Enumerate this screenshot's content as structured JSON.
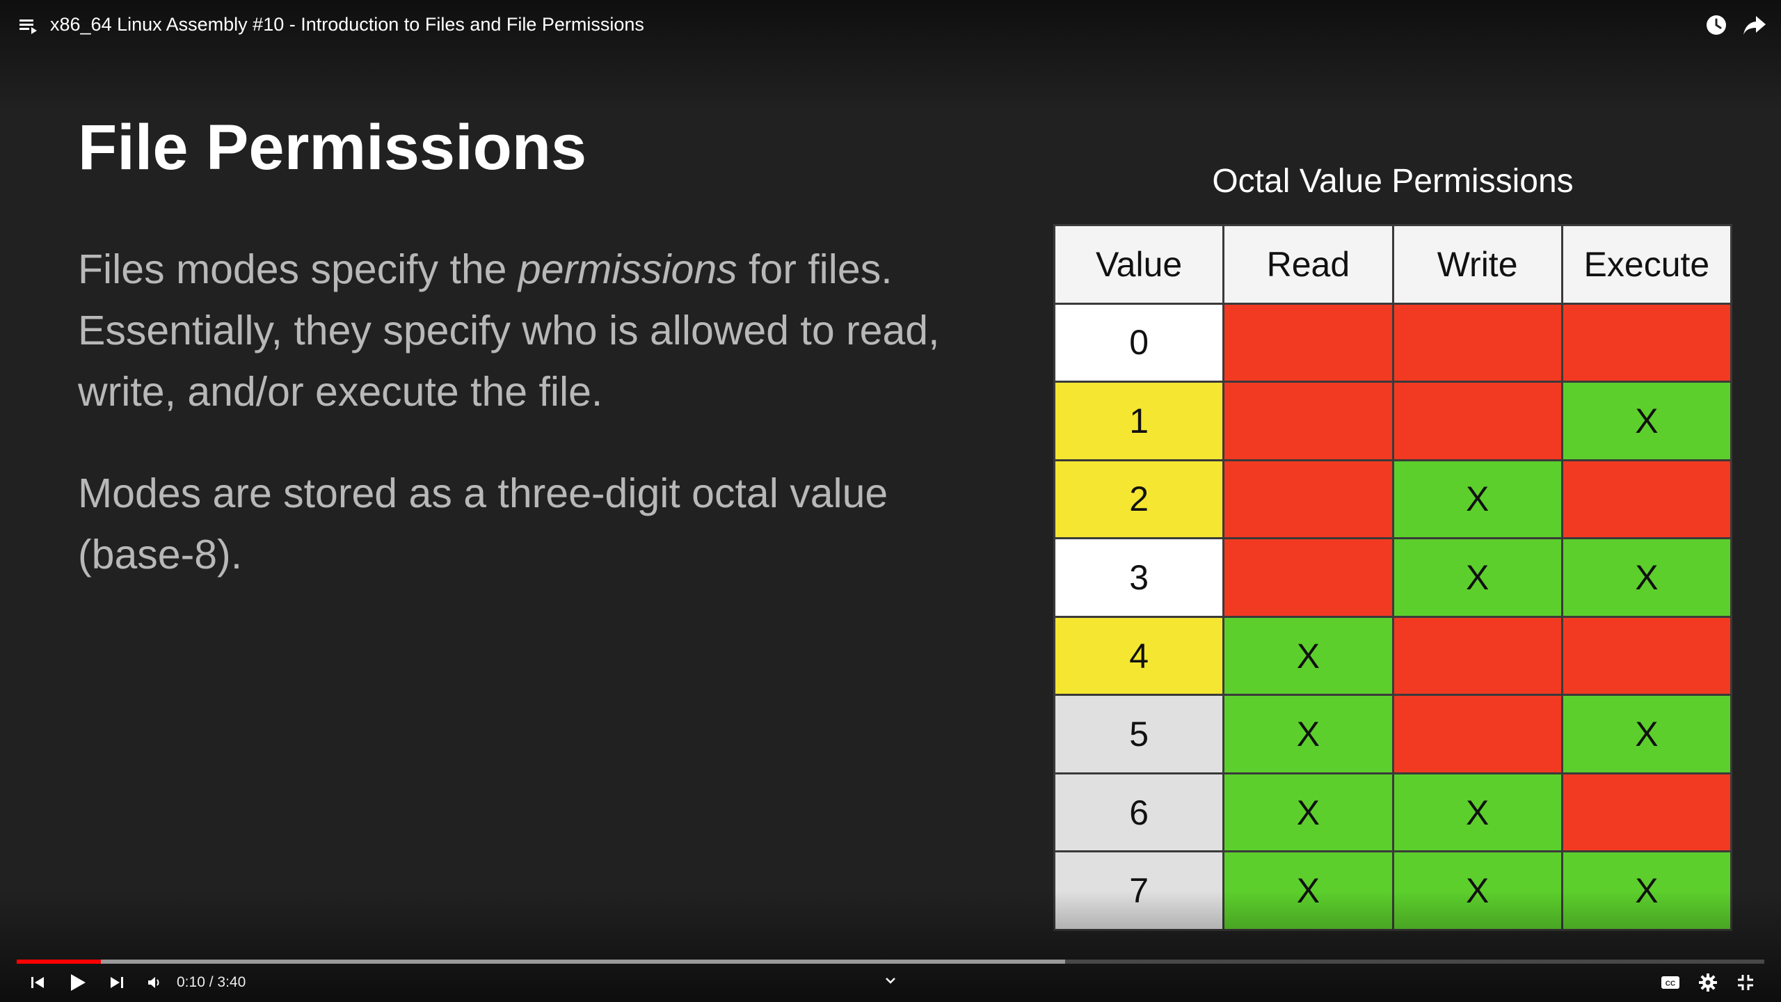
{
  "player": {
    "title": "x86_64 Linux Assembly #10 - Introduction to Files and File Permissions",
    "time_current": "0:10",
    "time_separator": " / ",
    "time_total": "3:40",
    "progress_played_fraction": 0.048,
    "progress_buffered_fraction": 0.6,
    "accent_color": "#ff0000"
  },
  "slide": {
    "title": "File Permissions",
    "para1_before": "Files modes specify the ",
    "para1_em": "permissions",
    "para1_after": " for files. Essentially, they specify who is allowed to read, write, and/or execute the file.",
    "para2": "Modes are stored as a three-digit octal value (base-8)."
  },
  "table": {
    "title": "Octal Value Permissions",
    "headers": [
      "Value",
      "Read",
      "Write",
      "Execute"
    ],
    "rows": [
      {
        "value": "0",
        "read": "",
        "write": "",
        "execute": ""
      },
      {
        "value": "1",
        "read": "",
        "write": "",
        "execute": "X"
      },
      {
        "value": "2",
        "read": "",
        "write": "X",
        "execute": ""
      },
      {
        "value": "3",
        "read": "",
        "write": "X",
        "execute": "X"
      },
      {
        "value": "4",
        "read": "X",
        "write": "",
        "execute": ""
      },
      {
        "value": "5",
        "read": "X",
        "write": "",
        "execute": "X"
      },
      {
        "value": "6",
        "read": "X",
        "write": "X",
        "execute": ""
      },
      {
        "value": "7",
        "read": "X",
        "write": "X",
        "execute": "X"
      }
    ],
    "value_cell_colors": [
      "#ffffff",
      "#f4e631",
      "#f4e631",
      "#ffffff",
      "#f4e631",
      "#e0e0e0",
      "#e0e0e0",
      "#e0e0e0"
    ],
    "granted_color": "#5ccf2c",
    "denied_color": "#f23a22"
  },
  "icons": {
    "playlist": "playlist-icon",
    "watch_later": "clock-icon",
    "share": "share-icon",
    "prev": "previous-icon",
    "play": "play-icon",
    "next": "next-icon",
    "volume": "volume-icon",
    "captions": "captions-icon",
    "settings": "gear-icon",
    "exit_fullscreen": "exit-fullscreen-icon",
    "chevron": "chevron-down-icon"
  }
}
